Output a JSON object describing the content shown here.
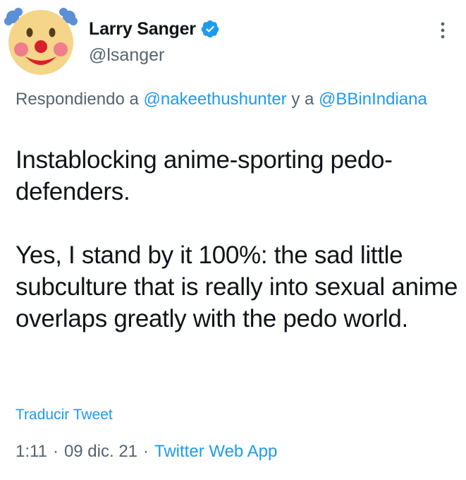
{
  "author": {
    "display_name": "Larry Sanger",
    "handle": "@lsanger",
    "verified": true,
    "avatar_icon": "clown-face-icon"
  },
  "reply_context": {
    "prefix": "Respondiendo a ",
    "mention_1": "@nakeethushunter",
    "joiner": " y a ",
    "mention_2": "@BBinIndiana"
  },
  "tweet": {
    "text": "Instablocking anime-sporting pedo-defenders.\n\nYes, I stand by it 100%: the sad little subculture that is really into sexual anime overlaps greatly with the pedo world."
  },
  "translate_label": "Traducir Tweet",
  "meta": {
    "time": "1:11",
    "separator": "·",
    "date": "09 dic. 21",
    "source": "Twitter Web App"
  },
  "colors": {
    "accent": "#1d9bf0",
    "secondary_text": "#536471",
    "primary_text": "#0f1419"
  }
}
